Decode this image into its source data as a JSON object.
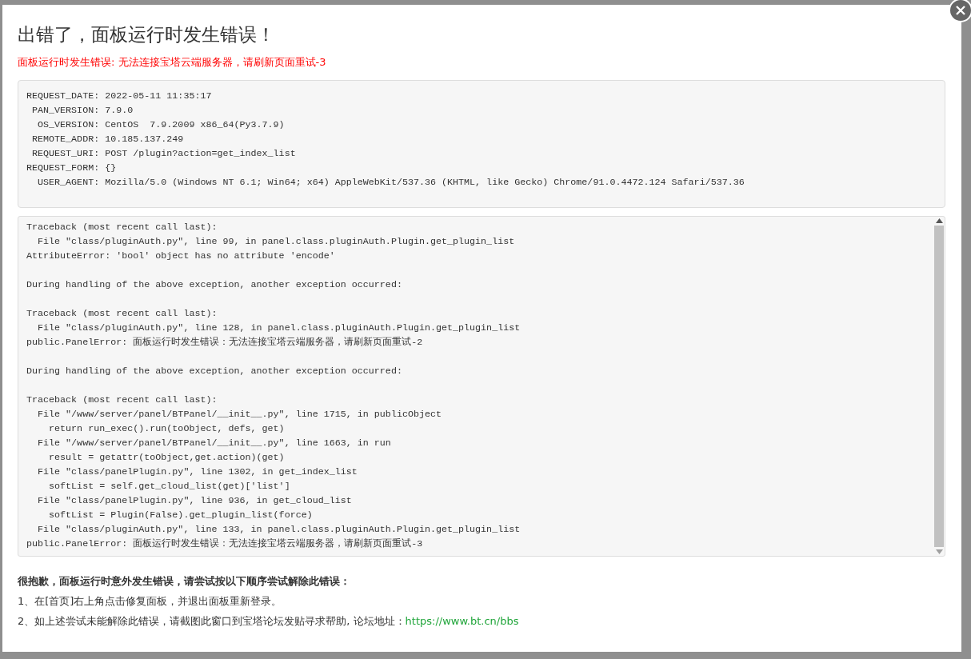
{
  "dialog": {
    "title": "出错了，面板运行时发生错误！",
    "error_message": "面板运行时发生错误: 无法连接宝塔云端服务器，请刷新页面重试-3",
    "request_info": [
      "REQUEST_DATE: 2022-05-11 11:35:17",
      " PAN_VERSION: 7.9.0",
      "  OS_VERSION: CentOS  7.9.2009 x86_64(Py3.7.9)",
      " REMOTE_ADDR: 10.185.137.249",
      " REQUEST_URI: POST /plugin?action=get_index_list",
      "REQUEST_FORM: {}",
      "  USER_AGENT: Mozilla/5.0 (Windows NT 6.1; Win64; x64) AppleWebKit/537.36 (KHTML, like Gecko) Chrome/91.0.4472.124 Safari/537.36"
    ],
    "traceback_blocks": [
      {
        "lines": [
          "Traceback (most recent call last):",
          "  File \"class/pluginAuth.py\", line 99, in panel.class.pluginAuth.Plugin.get_plugin_list",
          "AttributeError: 'bool' object has no attribute 'encode'"
        ]
      },
      {
        "lines": [
          "During handling of the above exception, another exception occurred:"
        ]
      },
      {
        "lines": [
          "Traceback (most recent call last):",
          "  File \"class/pluginAuth.py\", line 128, in panel.class.pluginAuth.Plugin.get_plugin_list",
          "public.PanelError: 面板运行时发生错误：无法连接宝塔云端服务器，请刷新页面重试-2"
        ]
      },
      {
        "lines": [
          "During handling of the above exception, another exception occurred:"
        ]
      },
      {
        "lines": [
          "Traceback (most recent call last):",
          "  File \"/www/server/panel/BTPanel/__init__.py\", line 1715, in publicObject",
          "    return run_exec().run(toObject, defs, get)",
          "  File \"/www/server/panel/BTPanel/__init__.py\", line 1663, in run",
          "    result = getattr(toObject,get.action)(get)",
          "  File \"class/panelPlugin.py\", line 1302, in get_index_list",
          "    softList = self.get_cloud_list(get)['list']",
          "  File \"class/panelPlugin.py\", line 936, in get_cloud_list",
          "    softList = Plugin(False).get_plugin_list(force)",
          "  File \"class/pluginAuth.py\", line 133, in panel.class.pluginAuth.Plugin.get_plugin_list",
          "public.PanelError: 面板运行时发生错误：无法连接宝塔云端服务器，请刷新页面重试-3"
        ]
      }
    ],
    "help": {
      "heading": "很抱歉，面板运行时意外发生错误，请尝试按以下顺序尝试解除此错误：",
      "steps": [
        {
          "text": "1、在[首页]右上角点击修复面板，并退出面板重新登录。"
        },
        {
          "text": "2、如上述尝试未能解除此错误，请截图此窗口到宝塔论坛发贴寻求帮助, 论坛地址：",
          "link": "https://www.bt.cn/bbs"
        }
      ]
    }
  }
}
